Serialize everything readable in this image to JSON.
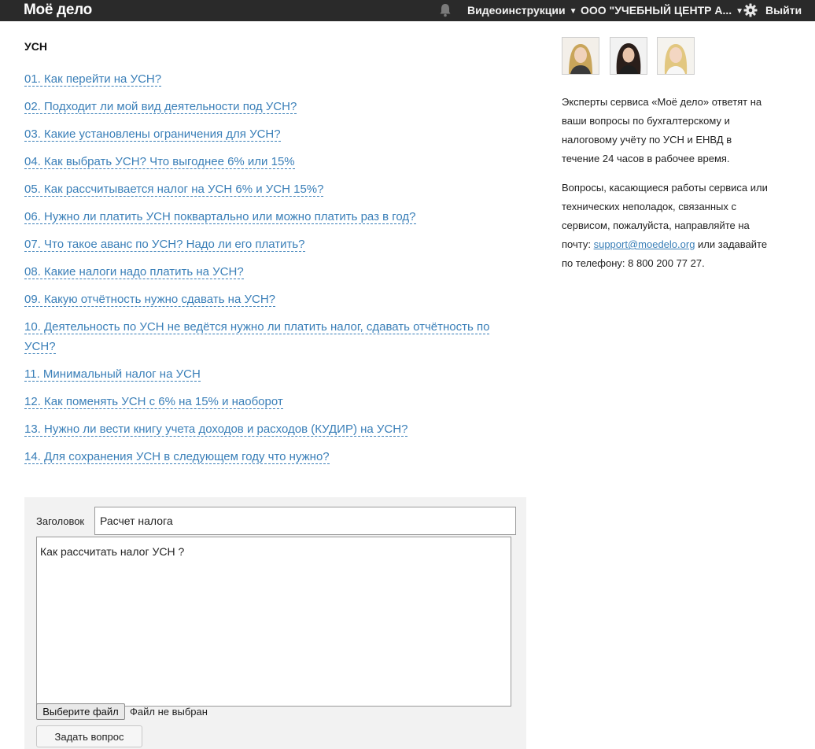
{
  "topbar": {
    "logo": "Моё дело",
    "video_label": "Видеоинструкции",
    "company_label": "ООО \"УЧЕБНЫЙ ЦЕНТР А...",
    "logout_label": "Выйти",
    "caret": "▼"
  },
  "main": {
    "title": "УСН",
    "faq": [
      "01. Как перейти на УСН?",
      "02. Подходит ли мой вид деятельности под УСН?",
      "03. Какие установлены ограничения для УСН?",
      "04. Как выбрать УСН? Что выгоднее 6% или 15%",
      "05. Как рассчитывается налог на УСН 6% и УСН 15%?",
      "06. Нужно ли платить УСН поквартально или можно платить раз в год?",
      "07. Что такое аванс по УСН? Надо ли его платить?",
      "08. Какие налоги надо платить на УСН?",
      "09. Какую отчётность нужно сдавать на УСН?",
      "10. Деятельность по УСН не ведётся нужно ли платить налог, сдавать отчётность по УСН?",
      "11. Минимальный налог на УСН",
      "12. Как поменять УСН с 6% на 15% и наоборот",
      "13. Нужно ли вести книгу учета доходов и расходов (КУДИР) на УСН?",
      "14. Для сохранения УСН в следующем году что нужно?"
    ]
  },
  "form": {
    "title_label": "Заголовок",
    "title_value": "Расчет налога",
    "body_value": "Как рассчитать налог УСН ?",
    "file_button": "Выберите файл",
    "file_status": "Файл не выбран",
    "submit_button": "Задать вопрос"
  },
  "sidebar": {
    "para1": "Эксперты сервиса «Моё дело» ответят на ваши вопросы по бухгалтерскому и налоговому учёту по УСН и ЕНВД в течение 24 часов в рабочее время.",
    "para2_before": "Вопросы, касающиеся работы сервиса или технических неполадок, связанных с сервисом, пожалуйста, направляйте на почту: ",
    "email": "support@moedelo.org",
    "para2_after": " или задавайте по телефону: 8 800 200 77 27."
  },
  "icons": {
    "bell": "bell-icon",
    "gear": "gear-icon",
    "avatars": [
      "expert-avatar-1",
      "expert-avatar-2",
      "expert-avatar-3"
    ]
  },
  "colors": {
    "topbar": "#2a2a2a",
    "link": "#3a7fb8",
    "form_bg": "#f2f2f2"
  }
}
